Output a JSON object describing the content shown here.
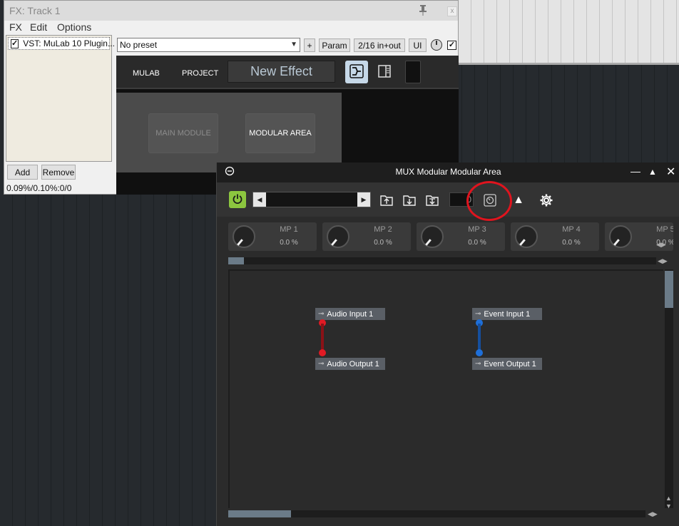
{
  "fx_window": {
    "title": "FX: Track 1",
    "menu": [
      "FX",
      "Edit",
      "Options"
    ],
    "plugin_item": "VST: MuLab 10 Plugin...",
    "plugin_checked": true,
    "add_label": "Add",
    "remove_label": "Remove",
    "cpu": "0.09%/0.10%:0/0",
    "preset": "No preset",
    "plus_label": "+",
    "param_label": "Param",
    "io_label": "2/16 in+out",
    "ui_label": "UI",
    "close_label": "x"
  },
  "mulab": {
    "tab_mulab": "MULAB",
    "tab_project": "PROJECT",
    "effect_name": "New Effect",
    "main_module": "MAIN MODULE",
    "modular_area": "MODULAR AREA"
  },
  "mux": {
    "title": "MUX Modular Modular Area",
    "number_value": "0",
    "params": [
      {
        "name": "MP 1",
        "value": "0.0 %"
      },
      {
        "name": "MP 2",
        "value": "0.0 %"
      },
      {
        "name": "MP 3",
        "value": "0.0 %"
      },
      {
        "name": "MP 4",
        "value": "0.0 %"
      },
      {
        "name": "MP 5",
        "value": "0.0 %"
      }
    ],
    "nodes": {
      "audio_input": "Audio Input 1",
      "audio_output": "Audio Output 1",
      "event_input": "Event Input 1",
      "event_output": "Event Output 1"
    }
  },
  "colors": {
    "power_green": "#8cc63f",
    "audio_wire": "#d0101a",
    "event_wire": "#1e6fd9",
    "highlight_circle": "#e0141e",
    "scroll_thumb": "#6b7b88"
  }
}
